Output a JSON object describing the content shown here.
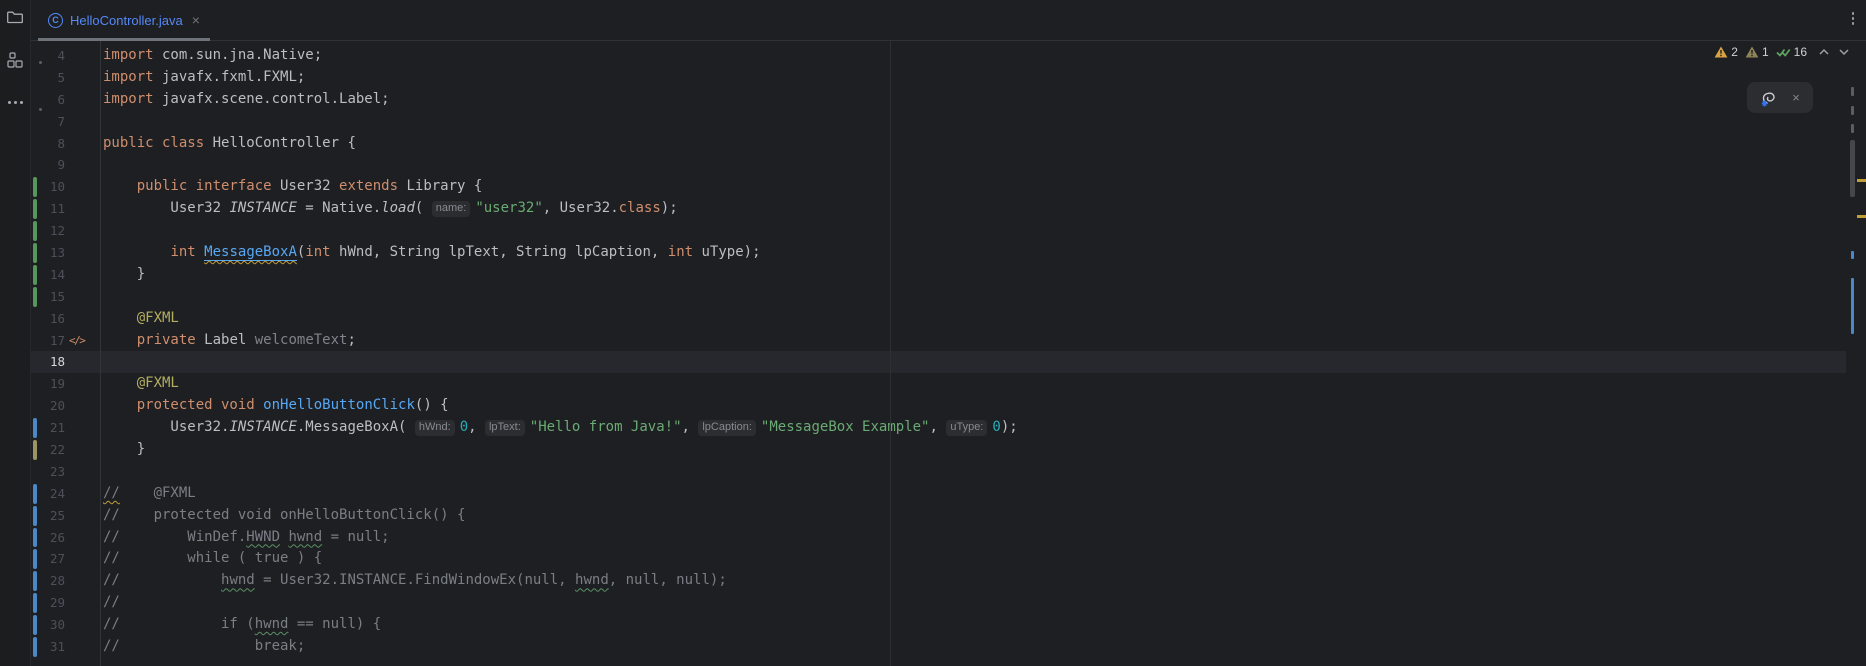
{
  "window": {
    "app": "IntelliJ IDEA editor",
    "colors": {
      "editor_bg": "#1E1F22",
      "caret_row_bg": "#26282E",
      "modified_file_blue": "#548AF7",
      "keyword_orange": "#CF8E6D",
      "string_green": "#6AAB73",
      "number_cyan": "#2AACB8",
      "annotation_olive": "#B3AE60",
      "method_blue": "#56A8F5",
      "comment_gray": "#7A7E85",
      "vcs_added_green": "#57965C",
      "vcs_modified_blue": "#4A88C7",
      "vcs_whitespace_olive": "#9C9563"
    }
  },
  "left_toolbar": {
    "items": [
      {
        "icon": "folder-icon"
      },
      {
        "icon": "structure-icon"
      },
      {
        "icon": "more-tool-windows-icon"
      }
    ]
  },
  "tab_bar": {
    "tabs": [
      {
        "label": "HelloController.java",
        "icon_letter": "C",
        "close_glyph": "×",
        "active": true,
        "modified": true
      }
    ]
  },
  "inspections": {
    "warnings_count": "2",
    "weak_warnings_count": "1",
    "passed_count": "16"
  },
  "ai_widget": {
    "close_glyph": "×"
  },
  "editor": {
    "current_line": 18,
    "first_visible_line": 4,
    "last_visible_line": 31,
    "lines": [
      {
        "n": 4,
        "seg": [
          {
            "s": "k",
            "t": "import"
          },
          {
            "s": "d",
            "t": " com.sun.jna.Native;"
          }
        ]
      },
      {
        "n": 5,
        "seg": [
          {
            "s": "k",
            "t": "import"
          },
          {
            "s": "d",
            "t": " javafx.fxml.FXML;"
          }
        ]
      },
      {
        "n": 6,
        "seg": [
          {
            "s": "k",
            "t": "import"
          },
          {
            "s": "d",
            "t": " javafx.scene.control.Label;"
          }
        ]
      },
      {
        "n": 7,
        "seg": []
      },
      {
        "n": 8,
        "seg": [
          {
            "s": "k",
            "t": "public class"
          },
          {
            "s": "d",
            "t": " HelloController {"
          }
        ]
      },
      {
        "n": 9,
        "seg": []
      },
      {
        "n": 10,
        "bar": "g",
        "seg": [
          {
            "s": "d",
            "t": "    "
          },
          {
            "s": "k",
            "t": "public interface"
          },
          {
            "s": "d",
            "t": " User32 "
          },
          {
            "s": "k",
            "t": "extends"
          },
          {
            "s": "d",
            "t": " Library {"
          }
        ]
      },
      {
        "n": 11,
        "bar": "g",
        "seg": [
          {
            "s": "d",
            "t": "        User32 "
          },
          {
            "s": "it",
            "t": "INSTANCE"
          },
          {
            "s": "d",
            "t": " = Native."
          },
          {
            "s": "it",
            "t": "load"
          },
          {
            "s": "d",
            "t": "( "
          },
          {
            "s": "p",
            "t": "name:"
          },
          {
            "s": "s",
            "t": "\"user32\""
          },
          {
            "s": "d",
            "t": ", User32."
          },
          {
            "s": "k",
            "t": "class"
          },
          {
            "s": "d",
            "t": ");"
          }
        ]
      },
      {
        "n": 12,
        "bar": "g",
        "seg": []
      },
      {
        "n": 13,
        "bar": "g",
        "seg": [
          {
            "s": "d",
            "t": "        "
          },
          {
            "s": "k",
            "t": "int"
          },
          {
            "s": "d",
            "t": " "
          },
          {
            "s": "mw",
            "t": "MessageBoxA"
          },
          {
            "s": "d",
            "t": "("
          },
          {
            "s": "k",
            "t": "int"
          },
          {
            "s": "d",
            "t": " hWnd, String lpText, String lpCaption, "
          },
          {
            "s": "k",
            "t": "int"
          },
          {
            "s": "d",
            "t": " uType);"
          }
        ]
      },
      {
        "n": 14,
        "bar": "g",
        "seg": [
          {
            "s": "d",
            "t": "    }"
          }
        ]
      },
      {
        "n": 15,
        "bar": "g",
        "seg": []
      },
      {
        "n": 16,
        "seg": [
          {
            "s": "d",
            "t": "    "
          },
          {
            "s": "a",
            "t": "@FXML"
          }
        ]
      },
      {
        "n": 17,
        "gutter_icon": "</>",
        "seg": [
          {
            "s": "d",
            "t": "    "
          },
          {
            "s": "k",
            "t": "private"
          },
          {
            "s": "d",
            "t": " Label "
          },
          {
            "s": "u",
            "t": "welcomeText"
          },
          {
            "s": "d",
            "t": ";"
          }
        ]
      },
      {
        "n": 18,
        "cur": true,
        "seg": []
      },
      {
        "n": 19,
        "seg": [
          {
            "s": "d",
            "t": "    "
          },
          {
            "s": "a",
            "t": "@FXML"
          }
        ]
      },
      {
        "n": 20,
        "seg": [
          {
            "s": "d",
            "t": "    "
          },
          {
            "s": "k",
            "t": "protected void"
          },
          {
            "s": "d",
            "t": " "
          },
          {
            "s": "m",
            "t": "onHelloButtonClick"
          },
          {
            "s": "d",
            "t": "() {"
          }
        ]
      },
      {
        "n": 21,
        "bar": "b",
        "seg": [
          {
            "s": "d",
            "t": "        User32."
          },
          {
            "s": "it",
            "t": "INSTANCE"
          },
          {
            "s": "d",
            "t": ".MessageBoxA( "
          },
          {
            "s": "p",
            "t": "hWnd:"
          },
          {
            "s": "n",
            "t": "0"
          },
          {
            "s": "d",
            "t": ", "
          },
          {
            "s": "p",
            "t": "lpText:"
          },
          {
            "s": "s",
            "t": "\"Hello from Java!\""
          },
          {
            "s": "d",
            "t": ", "
          },
          {
            "s": "p",
            "t": "lpCaption:"
          },
          {
            "s": "s",
            "t": "\"MessageBox Example\""
          },
          {
            "s": "d",
            "t": ", "
          },
          {
            "s": "p",
            "t": "uType:"
          },
          {
            "s": "n",
            "t": "0"
          },
          {
            "s": "d",
            "t": ");"
          }
        ]
      },
      {
        "n": 22,
        "bar": "y",
        "seg": [
          {
            "s": "d",
            "t": "    }"
          }
        ]
      },
      {
        "n": 23,
        "seg": []
      },
      {
        "n": 24,
        "bar": "b",
        "seg": [
          {
            "s": "cw2",
            "t": "//"
          },
          {
            "s": "c",
            "t": "    @FXML"
          }
        ]
      },
      {
        "n": 25,
        "bar": "b",
        "seg": [
          {
            "s": "c",
            "t": "//    protected void onHelloButtonClick() {"
          }
        ]
      },
      {
        "n": 26,
        "bar": "b",
        "seg": [
          {
            "s": "c",
            "t": "//        WinDef."
          },
          {
            "s": "cw",
            "t": "HWND"
          },
          {
            "s": "c",
            "t": " "
          },
          {
            "s": "cw",
            "t": "hwnd"
          },
          {
            "s": "c",
            "t": " = null;"
          }
        ]
      },
      {
        "n": 27,
        "bar": "b",
        "seg": [
          {
            "s": "c",
            "t": "//        while ( true ) {"
          }
        ]
      },
      {
        "n": 28,
        "bar": "b",
        "seg": [
          {
            "s": "c",
            "t": "//            "
          },
          {
            "s": "cw",
            "t": "hwnd"
          },
          {
            "s": "c",
            "t": " = User32.INSTANCE.FindWindowEx(null, "
          },
          {
            "s": "cw",
            "t": "hwnd"
          },
          {
            "s": "c",
            "t": ", null, null);"
          }
        ]
      },
      {
        "n": 29,
        "bar": "b",
        "seg": [
          {
            "s": "c",
            "t": "//"
          }
        ]
      },
      {
        "n": 30,
        "bar": "b",
        "seg": [
          {
            "s": "c",
            "t": "//            if ("
          },
          {
            "s": "cw",
            "t": "hwnd"
          },
          {
            "s": "c",
            "t": " == null) {"
          }
        ]
      },
      {
        "n": 31,
        "bar": "b",
        "seg": [
          {
            "s": "c",
            "t": "//                break;"
          }
        ]
      }
    ]
  }
}
